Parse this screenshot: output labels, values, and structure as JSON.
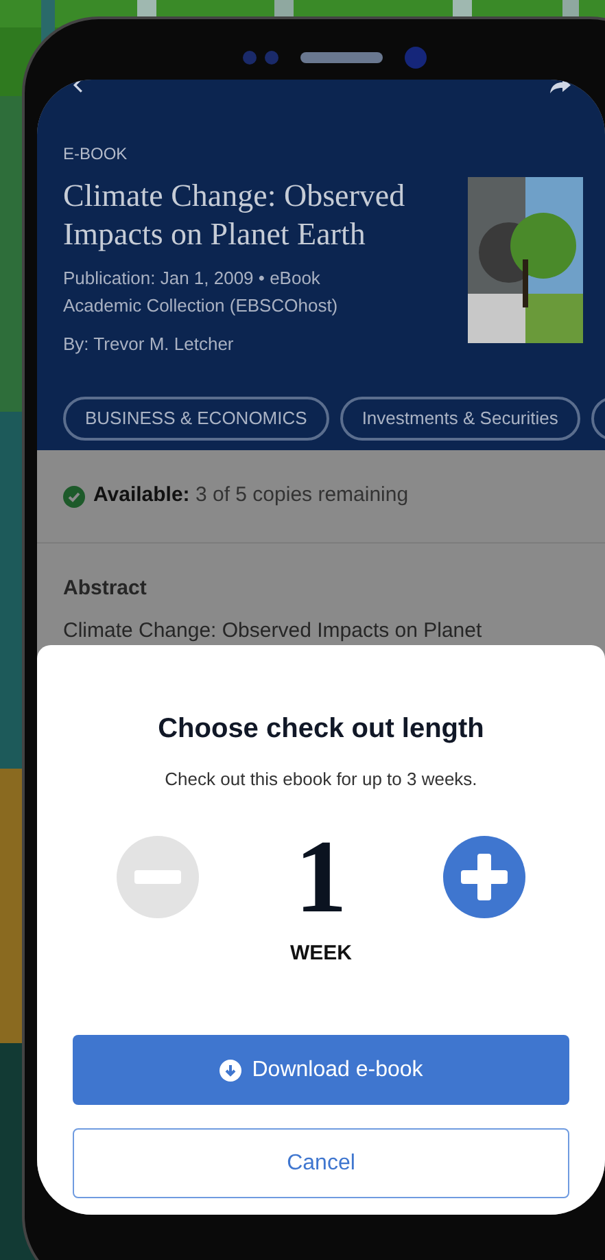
{
  "header": {
    "type_label": "E-BOOK",
    "title": "Climate Change: Observed Impacts on Planet Earth",
    "publication_label": "Publication:",
    "publication": "Jan 1, 2009 • eBook",
    "collection": "Academic Collection (EBSCOhost)",
    "author": "By: Trevor M. Letcher",
    "subjects": [
      {
        "label": "BUSINESS & ECONOMICS"
      },
      {
        "label": "Investments & Securities"
      },
      {
        "clipped": true
      }
    ]
  },
  "availability": {
    "available": true,
    "label": "Available:",
    "text": "3 of 5 copies remaining"
  },
  "abstract": {
    "heading": "Abstract",
    "text": "Climate Change: Observed Impacts on Planet"
  },
  "dialog": {
    "title": "Choose check out length",
    "subtitle": "Check out this ebook for up to 3 weeks.",
    "decrement_enabled": false,
    "increment_enabled": true,
    "value": "1",
    "unit": "WEEK",
    "primary_button": "Download e-book",
    "secondary_button": "Cancel"
  }
}
